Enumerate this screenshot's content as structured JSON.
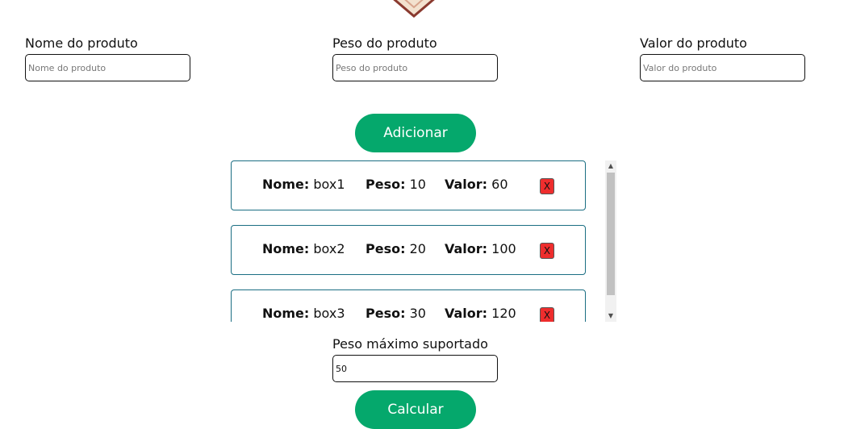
{
  "form": {
    "nome": {
      "label": "Nome do produto",
      "placeholder": "Nome do produto",
      "value": ""
    },
    "peso": {
      "label": "Peso do produto",
      "placeholder": "Peso do produto",
      "value": ""
    },
    "valor": {
      "label": "Valor do produto",
      "placeholder": "Valor do produto",
      "value": ""
    }
  },
  "add_button": "Adicionar",
  "items": [
    {
      "nome_label": "Nome:",
      "nome": " box1",
      "peso_label": "Peso:",
      "peso": " 10",
      "valor_label": "Valor:",
      "valor": " 60",
      "delete": "X"
    },
    {
      "nome_label": "Nome:",
      "nome": " box2",
      "peso_label": "Peso:",
      "peso": " 20",
      "valor_label": "Valor:",
      "valor": " 100",
      "delete": "X"
    },
    {
      "nome_label": "Nome:",
      "nome": " box3",
      "peso_label": "Peso:",
      "peso": " 30",
      "valor_label": "Valor:",
      "valor": " 120",
      "delete": "X"
    }
  ],
  "max_weight": {
    "label": "Peso máximo suportado",
    "value": "50"
  },
  "calc_button": "Calcular",
  "icons": {
    "scroll_up": "triangle-up-icon",
    "scroll_down": "triangle-down-icon"
  },
  "colors": {
    "button": "#05a86c",
    "item_border": "#1b6e83",
    "delete": "#ee2d2d"
  }
}
